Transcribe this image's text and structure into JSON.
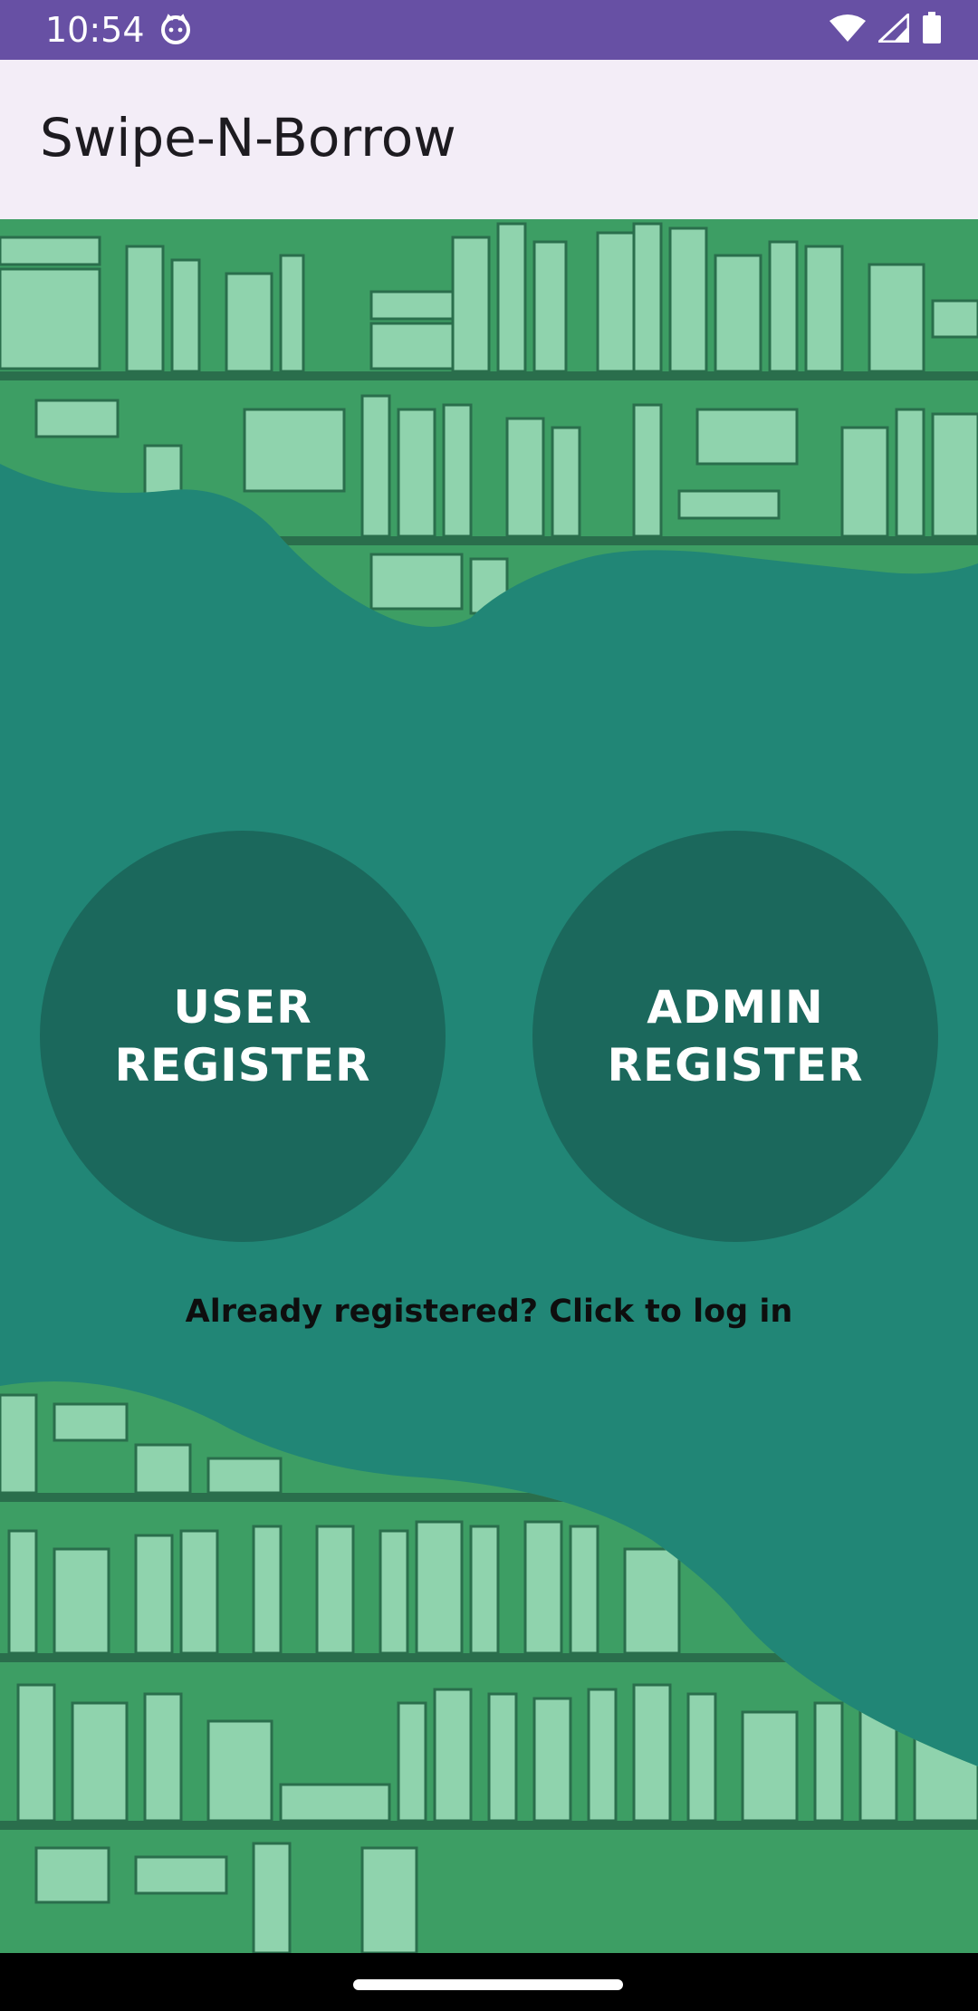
{
  "status_bar": {
    "time": "10:54",
    "icons": [
      "cat-notification-icon",
      "wifi-icon",
      "cell-signal-icon",
      "battery-icon"
    ]
  },
  "app_bar": {
    "title": "Swipe-N-Borrow"
  },
  "buttons": {
    "user_register": "USER\nREGISTER",
    "admin_register": "ADMIN\nREGISTER"
  },
  "login_link": "Already registered? Click to log in",
  "colors": {
    "status_bar": "#6750a4",
    "app_bar": "#f3edf7",
    "background": "#218676",
    "button": "#1b685c",
    "shelf_art": "#3d9e64"
  }
}
